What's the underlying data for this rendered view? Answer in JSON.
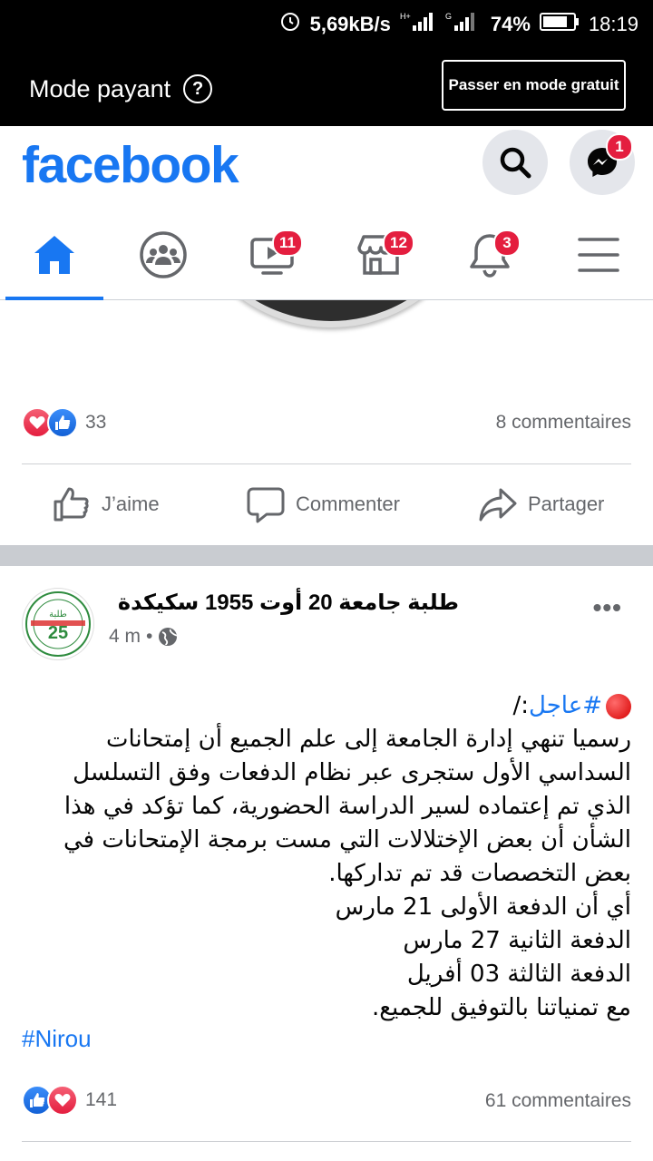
{
  "status_bar": {
    "speed": "5,69kB/s",
    "net1": "H+",
    "net2": "G",
    "battery": "74%",
    "time": "18:19"
  },
  "mode_bar": {
    "label": "Mode payant",
    "help_glyph": "?",
    "free_button": "Passer en mode gratuit"
  },
  "header": {
    "logo": "facebook",
    "messenger_badge": "1"
  },
  "nav": {
    "watch_badge": "11",
    "marketplace_badge": "12",
    "notifications_badge": "3",
    "accent": "#1877f2"
  },
  "post1": {
    "reaction_count": "33",
    "comments": "8 commentaires",
    "like_label": "J’aime",
    "comment_label": "Commenter",
    "share_label": "Partager"
  },
  "post2": {
    "page_name": "طلبة جامعة 20 أوت 1955 سكيكدة",
    "time": "4 m",
    "dot": "•",
    "more": "•••",
    "hashtag_urgent": "#عاجل",
    "urgent_suffix": ":/",
    "lines": [
      "رسميا تنهي إدارة الجامعة إلى علم الجميع أن إمتحانات السداسي الأول ستجرى عبر نظام الدفعات وفق التسلسل الذي تم إعتماده لسير الدراسة الحضورية، كما تؤكد في هذا الشأن أن بعض الإختلالات التي مست برمجة الإمتحانات في بعض التخصصات قد تم تداركها.",
      "أي أن الدفعة الأولى 21 مارس",
      "الدفعة الثانية 27 مارس",
      "الدفعة الثالثة 03 أفريل",
      "مع تمنياتنا بالتوفيق للجميع."
    ],
    "tag": "#Nirou",
    "reaction_count": "141",
    "comments": "61 commentaires",
    "avatar_text": "طلبة",
    "avatar_number": "25"
  }
}
